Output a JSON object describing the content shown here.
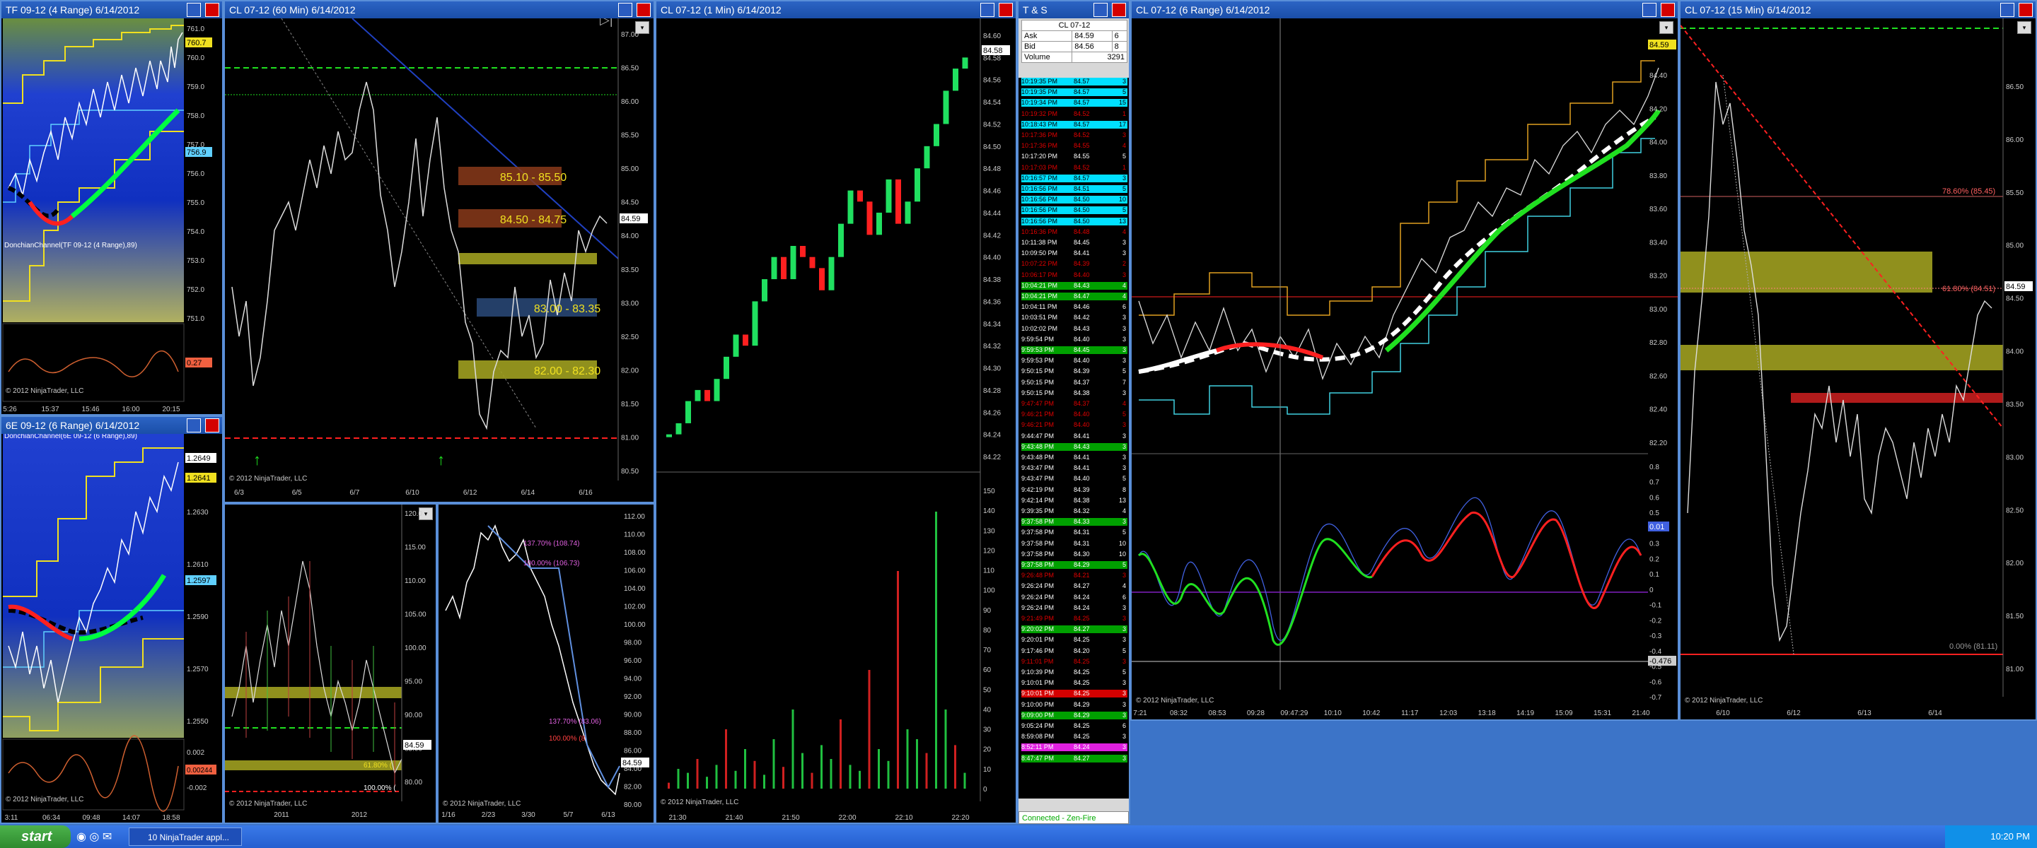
{
  "windows": {
    "tf": {
      "title": "TF 09-12 (4 Range)  6/14/2012",
      "indicator": "DonchianChannel(TF 09-12 (4 Range),89)",
      "price_tag": "760.7",
      "price_tag2": "756.9",
      "osc_tag": "0.27",
      "copyright": "© 2012 NinjaTrader, LLC"
    },
    "sixe": {
      "title": "6E 09-12 (6 Range)  6/14/2012",
      "indicator": "DonchianChannel(6E 09-12 (6 Range),89)",
      "price_tag": "1.2649",
      "price_tag2": "1.2641",
      "price_tag3": "1.2597",
      "osc_tag": "0.00244",
      "copyright": "© 2012 NinjaTrader, LLC"
    },
    "cl60": {
      "title": "CL 07-12 (60 Min)  6/14/2012",
      "copyright": "© 2012 NinjaTrader, LLC",
      "price_tag": "84.59",
      "zones": [
        "85.10 - 85.50",
        "84.50 - 84.75",
        "83.00 - 83.35",
        "82.00 - 82.30"
      ]
    },
    "cl_weekly": {
      "copyright": "© 2012 NinjaTrader, LLC",
      "price_tag": "84.59",
      "fib1": "61.80% (",
      "fib2": "100.00% ("
    },
    "cl_daily": {
      "copyright": "© 2012 NinjaTrader, LLC",
      "price_tag": "84.59",
      "fib1": "137.70% (108.74)",
      "fib2": "100.00% (106.73)",
      "fib3": "137.70% (83.06)",
      "fib4": "100.00% (8"
    },
    "cl1": {
      "title": "CL 07-12 (1 Min)  6/14/2012",
      "copyright": "© 2012 NinjaTrader, LLC",
      "price_tag": "84.58"
    },
    "tns": {
      "title": "T & S",
      "instrument": "CL 07-12",
      "ask_label": "Ask",
      "ask_price": "84.59",
      "ask_size": "6",
      "bid_label": "Bid",
      "bid_price": "84.56",
      "bid_size": "8",
      "volume_label": "Volume",
      "volume": "3291",
      "status": "Connected - Zen-Fire"
    },
    "cl6": {
      "title": "CL 07-12 (6 Range)  6/14/2012",
      "copyright": "© 2012 NinjaTrader, LLC",
      "price_tag": "84.59",
      "osc_tag1": "0.01",
      "osc_tag2": "-0.476",
      "cursor_time": "09:47:29"
    },
    "cl15": {
      "title": "CL 07-12 (15 Min)  6/14/2012",
      "copyright": "© 2012 NinjaTrader, LLC",
      "price_tag": "84.59",
      "fib1": "78.60% (85.45)",
      "fib2": "61.80% (84.51)",
      "fib3": "0.00% (81.11)"
    }
  },
  "axes": {
    "tf_y": [
      "761.0",
      "760.0",
      "759.0",
      "758.0",
      "757.0",
      "756.0",
      "755.0",
      "754.0",
      "753.0",
      "752.0",
      "751.0"
    ],
    "tf_x": [
      "5:26",
      "15:37",
      "15:46",
      "16:00",
      "20:15"
    ],
    "sixe_y": [
      "1.2650",
      "1.2630",
      "1.2610",
      "1.2590",
      "1.2570",
      "1.2550"
    ],
    "sixe_osc_y": [
      "0.002",
      "0",
      "-0.002"
    ],
    "sixe_x": [
      "3:11",
      "06:34",
      "09:48",
      "14:07",
      "18:58"
    ],
    "cl60_y": [
      "87.00",
      "86.50",
      "86.00",
      "85.50",
      "85.00",
      "84.50",
      "84.00",
      "83.50",
      "83.00",
      "82.50",
      "82.00",
      "81.50",
      "81.00",
      "80.50"
    ],
    "cl60_x": [
      "6/3",
      "6/5",
      "6/7",
      "6/10",
      "6/12",
      "6/14",
      "6/16"
    ],
    "clw_y": [
      "120.0",
      "115.00",
      "110.00",
      "105.00",
      "100.00",
      "95.00",
      "90.00",
      "85.00",
      "80.00"
    ],
    "clw_x": [
      "2011",
      "2012"
    ],
    "cld_y": [
      "112.00",
      "110.00",
      "108.00",
      "106.00",
      "104.00",
      "102.00",
      "100.00",
      "98.00",
      "96.00",
      "94.00",
      "92.00",
      "90.00",
      "88.00",
      "86.00",
      "84.00",
      "82.00",
      "80.00"
    ],
    "cld_x": [
      "1/16",
      "2/23",
      "3/30",
      "5/7",
      "6/13"
    ],
    "cl1_y": [
      "84.60",
      "84.58",
      "84.56",
      "84.54",
      "84.52",
      "84.50",
      "84.48",
      "84.46",
      "84.44",
      "84.42",
      "84.40",
      "84.38",
      "84.36",
      "84.34",
      "84.32",
      "84.30",
      "84.28",
      "84.26",
      "84.24",
      "84.22"
    ],
    "cl1_vol_y": [
      "150",
      "140",
      "130",
      "120",
      "110",
      "100",
      "90",
      "80",
      "70",
      "60",
      "50",
      "40",
      "30",
      "20",
      "10",
      "0"
    ],
    "cl1_x": [
      "21:30",
      "21:40",
      "21:50",
      "22:00",
      "22:10",
      "22:20"
    ],
    "cl6_y": [
      "84.40",
      "84.20",
      "84.00",
      "83.80",
      "83.60",
      "83.40",
      "83.20",
      "83.00",
      "82.80",
      "82.60",
      "82.40",
      "82.20"
    ],
    "cl6_osc_y": [
      "0.8",
      "0.7",
      "0.6",
      "0.5",
      "0.4",
      "0.3",
      "0.2",
      "0.1",
      "0",
      "-0.1",
      "-0.2",
      "-0.3",
      "-0.4",
      "-0.5",
      "-0.6",
      "-0.7"
    ],
    "cl6_x": [
      "7:21",
      "08:32",
      "08:53",
      "09:28",
      "09:47:29",
      "10:10",
      "10:42",
      "11:17",
      "12:03",
      "13:18",
      "14:19",
      "15:09",
      "15:31",
      "21:40"
    ],
    "cl15_y": [
      "86.50",
      "86.00",
      "85.50",
      "85.00",
      "84.50",
      "84.00",
      "83.50",
      "83.00",
      "82.50",
      "82.00",
      "81.50",
      "81.00"
    ],
    "cl15_x": [
      "6/10",
      "6/12",
      "6/13",
      "6/14"
    ]
  },
  "tns_rows": [
    {
      "t": "10:19:35 PM",
      "p": "84.57",
      "s": "3",
      "bg": "#00e0ff",
      "fg": "#000"
    },
    {
      "t": "10:19:35 PM",
      "p": "84.57",
      "s": "5",
      "bg": "#00e0ff",
      "fg": "#000"
    },
    {
      "t": "10:19:34 PM",
      "p": "84.57",
      "s": "15",
      "bg": "#00e0ff",
      "fg": "#000"
    },
    {
      "t": "10:19:32 PM",
      "p": "84.52",
      "s": "1",
      "bg": "#000",
      "fg": "#e00000"
    },
    {
      "t": "10:18:43 PM",
      "p": "84.57",
      "s": "17",
      "bg": "#00e0ff",
      "fg": "#000"
    },
    {
      "t": "10:17:36 PM",
      "p": "84.52",
      "s": "3",
      "bg": "#000",
      "fg": "#e00000"
    },
    {
      "t": "10:17:36 PM",
      "p": "84.55",
      "s": "4",
      "bg": "#000",
      "fg": "#e00000"
    },
    {
      "t": "10:17:20 PM",
      "p": "84.55",
      "s": "5",
      "bg": "#000",
      "fg": "#fff"
    },
    {
      "t": "10:17:03 PM",
      "p": "84.52",
      "s": "1",
      "bg": "#000",
      "fg": "#e00000"
    },
    {
      "t": "10:16:57 PM",
      "p": "84.57",
      "s": "3",
      "bg": "#00e0ff",
      "fg": "#000"
    },
    {
      "t": "10:16:56 PM",
      "p": "84.51",
      "s": "5",
      "bg": "#00e0ff",
      "fg": "#000"
    },
    {
      "t": "10:16:56 PM",
      "p": "84.50",
      "s": "10",
      "bg": "#00e0ff",
      "fg": "#000"
    },
    {
      "t": "10:16:56 PM",
      "p": "84.50",
      "s": "5",
      "bg": "#00e0ff",
      "fg": "#000"
    },
    {
      "t": "10:16:56 PM",
      "p": "84.50",
      "s": "13",
      "bg": "#00e0ff",
      "fg": "#000"
    },
    {
      "t": "10:16:36 PM",
      "p": "84.48",
      "s": "4",
      "bg": "#000",
      "fg": "#e00000"
    },
    {
      "t": "10:11:38 PM",
      "p": "84.45",
      "s": "3",
      "bg": "#000",
      "fg": "#fff"
    },
    {
      "t": "10:09:50 PM",
      "p": "84.41",
      "s": "3",
      "bg": "#000",
      "fg": "#fff"
    },
    {
      "t": "10:07:22 PM",
      "p": "84.39",
      "s": "2",
      "bg": "#000",
      "fg": "#e00000"
    },
    {
      "t": "10:06:17 PM",
      "p": "84.40",
      "s": "3",
      "bg": "#000",
      "fg": "#e00000"
    },
    {
      "t": "10:04:21 PM",
      "p": "84.43",
      "s": "4",
      "bg": "#00a000",
      "fg": "#fff"
    },
    {
      "t": "10:04:21 PM",
      "p": "84.47",
      "s": "4",
      "bg": "#00a000",
      "fg": "#fff"
    },
    {
      "t": "10:04:11 PM",
      "p": "84.46",
      "s": "6",
      "bg": "#000",
      "fg": "#fff"
    },
    {
      "t": "10:03:51 PM",
      "p": "84.42",
      "s": "3",
      "bg": "#000",
      "fg": "#fff"
    },
    {
      "t": "10:02:02 PM",
      "p": "84.43",
      "s": "3",
      "bg": "#000",
      "fg": "#fff"
    },
    {
      "t": "9:59:54 PM",
      "p": "84.40",
      "s": "3",
      "bg": "#000",
      "fg": "#fff"
    },
    {
      "t": "9:59:53 PM",
      "p": "84.45",
      "s": "3",
      "bg": "#00a000",
      "fg": "#fff"
    },
    {
      "t": "9:59:53 PM",
      "p": "84.40",
      "s": "3",
      "bg": "#000",
      "fg": "#fff"
    },
    {
      "t": "9:50:15 PM",
      "p": "84.39",
      "s": "5",
      "bg": "#000",
      "fg": "#fff"
    },
    {
      "t": "9:50:15 PM",
      "p": "84.37",
      "s": "7",
      "bg": "#000",
      "fg": "#fff"
    },
    {
      "t": "9:50:15 PM",
      "p": "84.38",
      "s": "3",
      "bg": "#000",
      "fg": "#fff"
    },
    {
      "t": "9:47:47 PM",
      "p": "84.37",
      "s": "4",
      "bg": "#000",
      "fg": "#e00000"
    },
    {
      "t": "9:46:21 PM",
      "p": "84.40",
      "s": "5",
      "bg": "#000",
      "fg": "#e00000"
    },
    {
      "t": "9:46:21 PM",
      "p": "84.40",
      "s": "3",
      "bg": "#000",
      "fg": "#e00000"
    },
    {
      "t": "9:44:47 PM",
      "p": "84.41",
      "s": "3",
      "bg": "#000",
      "fg": "#fff"
    },
    {
      "t": "9:43:48 PM",
      "p": "84.43",
      "s": "3",
      "bg": "#00a000",
      "fg": "#fff"
    },
    {
      "t": "9:43:48 PM",
      "p": "84.41",
      "s": "3",
      "bg": "#000",
      "fg": "#fff"
    },
    {
      "t": "9:43:47 PM",
      "p": "84.41",
      "s": "3",
      "bg": "#000",
      "fg": "#fff"
    },
    {
      "t": "9:43:47 PM",
      "p": "84.40",
      "s": "5",
      "bg": "#000",
      "fg": "#fff"
    },
    {
      "t": "9:42:19 PM",
      "p": "84.39",
      "s": "8",
      "bg": "#000",
      "fg": "#fff"
    },
    {
      "t": "9:42:14 PM",
      "p": "84.38",
      "s": "13",
      "bg": "#000",
      "fg": "#fff"
    },
    {
      "t": "9:39:35 PM",
      "p": "84.32",
      "s": "4",
      "bg": "#000",
      "fg": "#fff"
    },
    {
      "t": "9:37:58 PM",
      "p": "84.33",
      "s": "3",
      "bg": "#00a000",
      "fg": "#fff"
    },
    {
      "t": "9:37:58 PM",
      "p": "84.31",
      "s": "5",
      "bg": "#000",
      "fg": "#fff"
    },
    {
      "t": "9:37:58 PM",
      "p": "84.31",
      "s": "10",
      "bg": "#000",
      "fg": "#fff"
    },
    {
      "t": "9:37:58 PM",
      "p": "84.30",
      "s": "10",
      "bg": "#000",
      "fg": "#fff"
    },
    {
      "t": "9:37:58 PM",
      "p": "84.29",
      "s": "5",
      "bg": "#00a000",
      "fg": "#fff"
    },
    {
      "t": "9:26:48 PM",
      "p": "84.21",
      "s": "3",
      "bg": "#000",
      "fg": "#e00000"
    },
    {
      "t": "9:26:24 PM",
      "p": "84.27",
      "s": "4",
      "bg": "#000",
      "fg": "#fff"
    },
    {
      "t": "9:26:24 PM",
      "p": "84.24",
      "s": "6",
      "bg": "#000",
      "fg": "#fff"
    },
    {
      "t": "9:26:24 PM",
      "p": "84.24",
      "s": "3",
      "bg": "#000",
      "fg": "#fff"
    },
    {
      "t": "9:21:49 PM",
      "p": "84.25",
      "s": "3",
      "bg": "#000",
      "fg": "#e00000"
    },
    {
      "t": "9:20:02 PM",
      "p": "84.27",
      "s": "3",
      "bg": "#00a000",
      "fg": "#fff"
    },
    {
      "t": "9:20:01 PM",
      "p": "84.25",
      "s": "3",
      "bg": "#000",
      "fg": "#fff"
    },
    {
      "t": "9:17:46 PM",
      "p": "84.20",
      "s": "5",
      "bg": "#000",
      "fg": "#fff"
    },
    {
      "t": "9:11:01 PM",
      "p": "84.25",
      "s": "3",
      "bg": "#000",
      "fg": "#e00000"
    },
    {
      "t": "9:10:39 PM",
      "p": "84.25",
      "s": "5",
      "bg": "#000",
      "fg": "#fff"
    },
    {
      "t": "9:10:01 PM",
      "p": "84.25",
      "s": "3",
      "bg": "#000",
      "fg": "#fff"
    },
    {
      "t": "9:10:01 PM",
      "p": "84.25",
      "s": "3",
      "bg": "#d40000",
      "fg": "#fff"
    },
    {
      "t": "9:10:00 PM",
      "p": "84.29",
      "s": "3",
      "bg": "#000",
      "fg": "#fff"
    },
    {
      "t": "9:09:00 PM",
      "p": "84.29",
      "s": "3",
      "bg": "#00a000",
      "fg": "#fff"
    },
    {
      "t": "9:05:24 PM",
      "p": "84.25",
      "s": "6",
      "bg": "#000",
      "fg": "#fff"
    },
    {
      "t": "8:59:08 PM",
      "p": "84.25",
      "s": "3",
      "bg": "#000",
      "fg": "#fff"
    },
    {
      "t": "8:52:11 PM",
      "p": "84.24",
      "s": "3",
      "bg": "#e020e0",
      "fg": "#fff"
    },
    {
      "t": "8:47:47 PM",
      "p": "84.27",
      "s": "3",
      "bg": "#00a000",
      "fg": "#fff"
    }
  ],
  "taskbar": {
    "start": "start",
    "task": "10 NinjaTrader appl...",
    "clock": "10:20 PM"
  },
  "colors": {
    "green": "#00ff40",
    "red": "#ff2020",
    "yellow": "#f0e020",
    "cyan": "#40d0ff"
  }
}
